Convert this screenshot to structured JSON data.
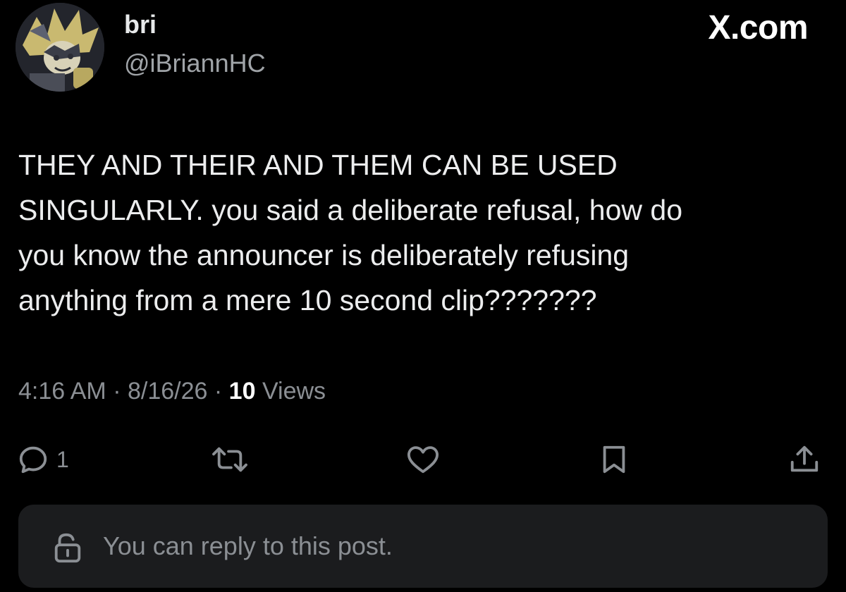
{
  "author": {
    "display_name": "bri",
    "handle": "@iBriannHC"
  },
  "brand": "X.com",
  "post": {
    "text": "THEY AND THEIR AND THEM CAN BE USED\nSINGULARLY. you said a deliberate refusal, how do\nyou know the announcer is deliberately refusing\nanything from a mere 10 second clip???????"
  },
  "meta": {
    "time": "4:16 AM",
    "separator": "·",
    "date": "8/16/26",
    "views_count": "10",
    "views_label": "Views"
  },
  "actions": {
    "reply_icon": "reply-icon",
    "reply_count": "1",
    "repost_icon": "repost-icon",
    "like_icon": "heart-icon",
    "bookmark_icon": "bookmark-icon",
    "share_icon": "share-icon"
  },
  "reply_bar": {
    "icon": "unlock-icon",
    "text": "You can reply to this post."
  },
  "colors": {
    "background": "#000000",
    "text": "#e7e9ea",
    "muted": "#8b8f94",
    "reply_bar_bg": "#1b1c1e"
  }
}
